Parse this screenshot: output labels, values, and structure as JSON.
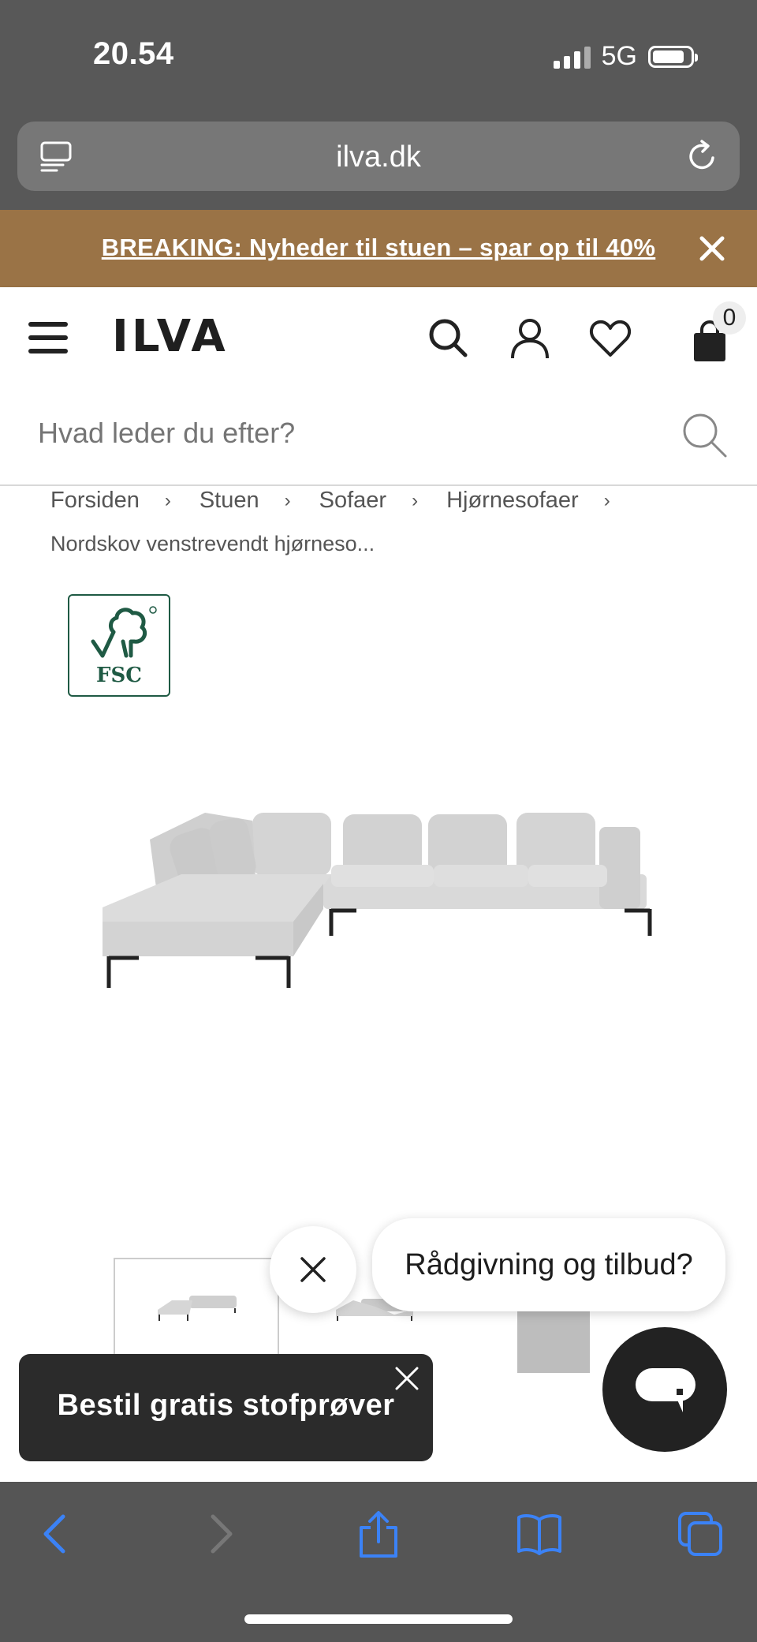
{
  "status_bar": {
    "time": "20.54",
    "network": "5G"
  },
  "browser": {
    "url": "ilva.dk"
  },
  "banner": {
    "text": "BREAKING: Nyheder til stuen – spar op til 40%"
  },
  "header": {
    "logo": "ILVA",
    "cart_count": "0"
  },
  "search": {
    "placeholder": "Hvad leder du efter?"
  },
  "breadcrumbs": {
    "items": [
      "Forsiden",
      "Stuen",
      "Sofaer",
      "Hjørnesofaer"
    ],
    "separator": "›",
    "current": "Nordskov venstrevendt hjørneso..."
  },
  "badge": {
    "label": "FSC"
  },
  "chat": {
    "bubble_text": "Rådgivning og tilbud?"
  },
  "toast": {
    "text": "Bestil gratis stofprøver"
  },
  "colors": {
    "banner": "#9a7346",
    "browser_chrome": "#585858",
    "safari_icon": "#3b82f6",
    "fsc_green": "#1f5a44"
  },
  "icons": {
    "browser": [
      "reader-icon",
      "reload-icon"
    ],
    "header": [
      "menu-icon",
      "search-icon",
      "user-icon",
      "heart-icon",
      "cart-icon"
    ],
    "safari": [
      "back-icon",
      "forward-icon",
      "share-icon",
      "bookmarks-icon",
      "tabs-icon"
    ]
  }
}
